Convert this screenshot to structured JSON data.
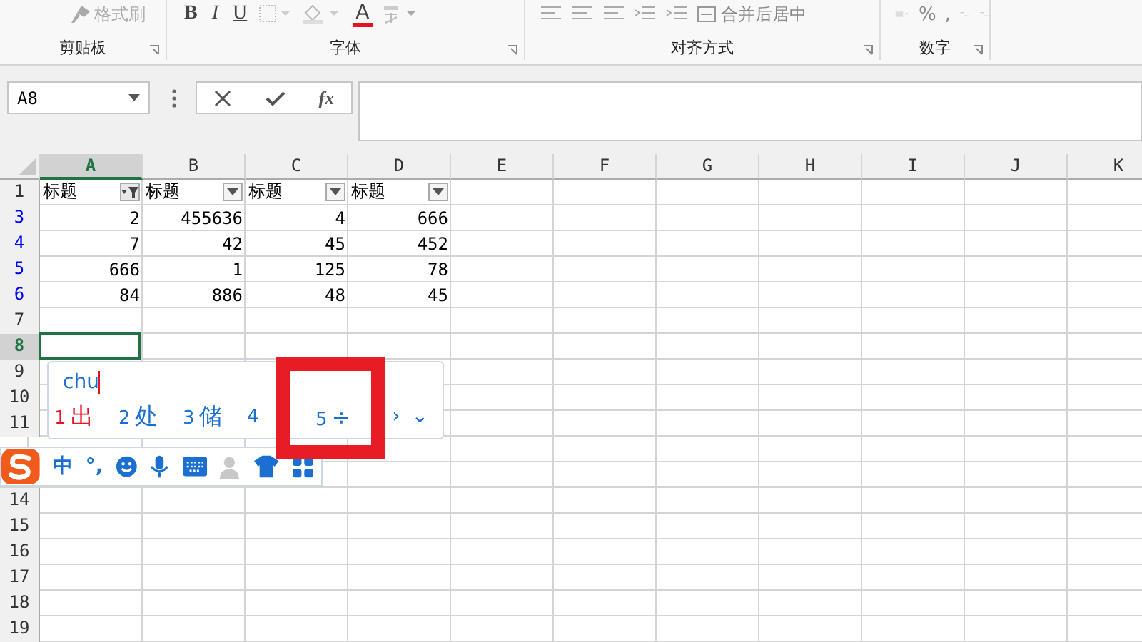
{
  "ribbon": {
    "groups": [
      {
        "label": "剪贴板",
        "tools": [
          {
            "kind": "brush",
            "text": "格式刷"
          }
        ]
      },
      {
        "label": "字体",
        "tools": [
          {
            "kind": "bold",
            "text": "B"
          },
          {
            "kind": "italic",
            "text": "I"
          },
          {
            "kind": "underline",
            "text": "U"
          },
          {
            "kind": "border"
          },
          {
            "kind": "fill"
          },
          {
            "kind": "fontcolor",
            "text": "A"
          },
          {
            "kind": "phonetic"
          }
        ]
      },
      {
        "label": "对齐方式",
        "tools": [
          {
            "kind": "align"
          },
          {
            "kind": "align"
          },
          {
            "kind": "align"
          },
          {
            "kind": "indent"
          },
          {
            "kind": "indent"
          },
          {
            "kind": "merge",
            "text": "合并后居中"
          }
        ]
      },
      {
        "label": "数字",
        "tools": [
          {
            "kind": "currency"
          },
          {
            "kind": "text",
            "text": "%"
          },
          {
            "kind": "text",
            "text": ","
          },
          {
            "kind": "decimal"
          },
          {
            "kind": "decimal"
          }
        ]
      }
    ]
  },
  "formula_bar": {
    "name_box": "A8",
    "fx": "fx"
  },
  "sheet": {
    "columns": [
      {
        "label": "A",
        "selected": true
      },
      {
        "label": "B",
        "selected": false
      },
      {
        "label": "C",
        "selected": false
      },
      {
        "label": "D",
        "selected": false
      },
      {
        "label": "E",
        "selected": false
      },
      {
        "label": "F",
        "selected": false
      },
      {
        "label": "G",
        "selected": false
      },
      {
        "label": "H",
        "selected": false
      },
      {
        "label": "I",
        "selected": false
      },
      {
        "label": "J",
        "selected": false
      },
      {
        "label": "K",
        "selected": false
      }
    ],
    "rows": [
      {
        "number": "1",
        "selected": false,
        "filtered": false,
        "cells": [
          {
            "text": "标题",
            "kind": "header",
            "filter_active": true
          },
          {
            "text": "标题",
            "kind": "header",
            "filter_active": false
          },
          {
            "text": "标题",
            "kind": "header",
            "filter_active": false
          },
          {
            "text": "标题",
            "kind": "header",
            "filter_active": false
          }
        ]
      },
      {
        "number": "3",
        "selected": false,
        "filtered": true,
        "cells": [
          {
            "text": "2"
          },
          {
            "text": "455636"
          },
          {
            "text": "4"
          },
          {
            "text": "666"
          }
        ]
      },
      {
        "number": "4",
        "selected": false,
        "filtered": true,
        "cells": [
          {
            "text": "7"
          },
          {
            "text": "42"
          },
          {
            "text": "45"
          },
          {
            "text": "452"
          }
        ]
      },
      {
        "number": "5",
        "selected": false,
        "filtered": true,
        "cells": [
          {
            "text": "666"
          },
          {
            "text": "1"
          },
          {
            "text": "125"
          },
          {
            "text": "78"
          }
        ]
      },
      {
        "number": "6",
        "selected": false,
        "filtered": true,
        "cells": [
          {
            "text": "84"
          },
          {
            "text": "886"
          },
          {
            "text": "48"
          },
          {
            "text": "45"
          }
        ]
      },
      {
        "number": "7",
        "selected": false,
        "filtered": false,
        "cells": []
      },
      {
        "number": "8",
        "selected": true,
        "filtered": false,
        "cells": [
          {
            "active": true
          }
        ]
      },
      {
        "number": "9",
        "selected": false,
        "filtered": false,
        "cells": []
      },
      {
        "number": "10",
        "selected": false,
        "filtered": false,
        "cells": []
      },
      {
        "number": "11",
        "selected": false,
        "filtered": false,
        "cells": []
      },
      {
        "kind": "covered"
      },
      {
        "kind": "covered"
      },
      {
        "number": "14",
        "selected": false,
        "filtered": false,
        "cells": []
      },
      {
        "number": "15",
        "selected": false,
        "filtered": false,
        "cells": []
      },
      {
        "number": "16",
        "selected": false,
        "filtered": false,
        "cells": []
      },
      {
        "number": "17",
        "selected": false,
        "filtered": false,
        "cells": []
      },
      {
        "number": "18",
        "selected": false,
        "filtered": false,
        "cells": []
      },
      {
        "number": "19",
        "selected": false,
        "filtered": false,
        "cells": []
      }
    ]
  },
  "ime": {
    "input": "chu",
    "candidates": [
      {
        "index": "1",
        "text": "出",
        "selected": true
      },
      {
        "index": "2",
        "text": "处",
        "selected": false
      },
      {
        "index": "3",
        "text": "储",
        "selected": false
      },
      {
        "index": "4",
        "selected": false
      },
      {
        "index": "5",
        "text": "÷",
        "selected": false
      }
    ],
    "next": "›",
    "expand": "⌄",
    "toolbar": [
      {
        "kind": "logo"
      },
      {
        "kind": "text",
        "text": "中"
      },
      {
        "kind": "text",
        "text": "°,"
      },
      {
        "kind": "smiley"
      },
      {
        "kind": "mic"
      },
      {
        "kind": "keyboard"
      },
      {
        "kind": "user",
        "disabled": true
      },
      {
        "kind": "shirt"
      },
      {
        "kind": "apps"
      }
    ]
  },
  "annotation": {
    "kind": "highlight-box"
  }
}
